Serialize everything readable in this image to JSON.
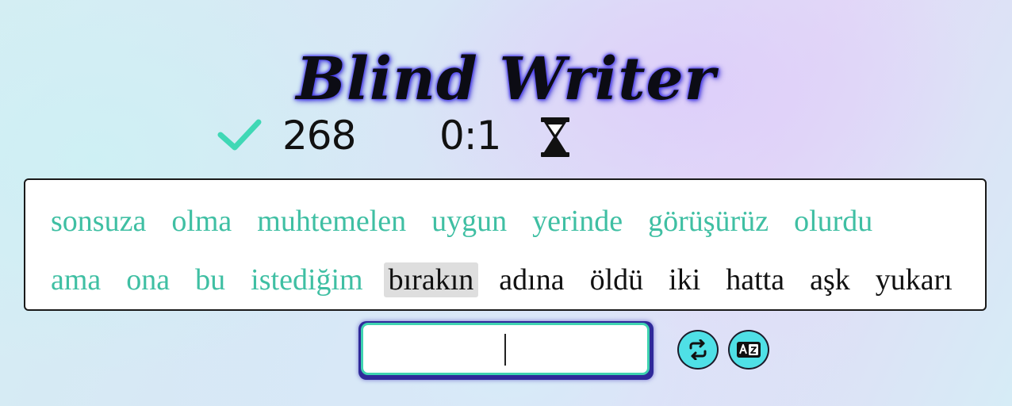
{
  "app": {
    "title": "Blind Writer"
  },
  "stats": {
    "correct_icon": "checkmark-icon",
    "correct_count": "268",
    "timer": "0:1",
    "timer_icon": "hourglass-icon"
  },
  "colors": {
    "typed_word": "#3fbfa3",
    "pending_word": "#111111",
    "current_word_bg": "#dedede",
    "input_border": "#3fd3b0",
    "button_bg": "#4fe0e6"
  },
  "text_panel": {
    "line1": [
      "sonsuza",
      "olma",
      "muhtemelen",
      "uygun",
      "yerinde",
      "görüşürüz",
      "olurdu"
    ],
    "line2_typed": [
      "ama",
      "ona",
      "bu",
      "istediğim"
    ],
    "current_word": "bırakın",
    "line2_pending": [
      "adına",
      "öldü",
      "iki",
      "hatta",
      "aşk",
      "yukarı"
    ]
  },
  "input": {
    "value": "",
    "placeholder": ""
  },
  "buttons": {
    "restart_icon": "restart-icon",
    "language_icon": "language-icon"
  }
}
